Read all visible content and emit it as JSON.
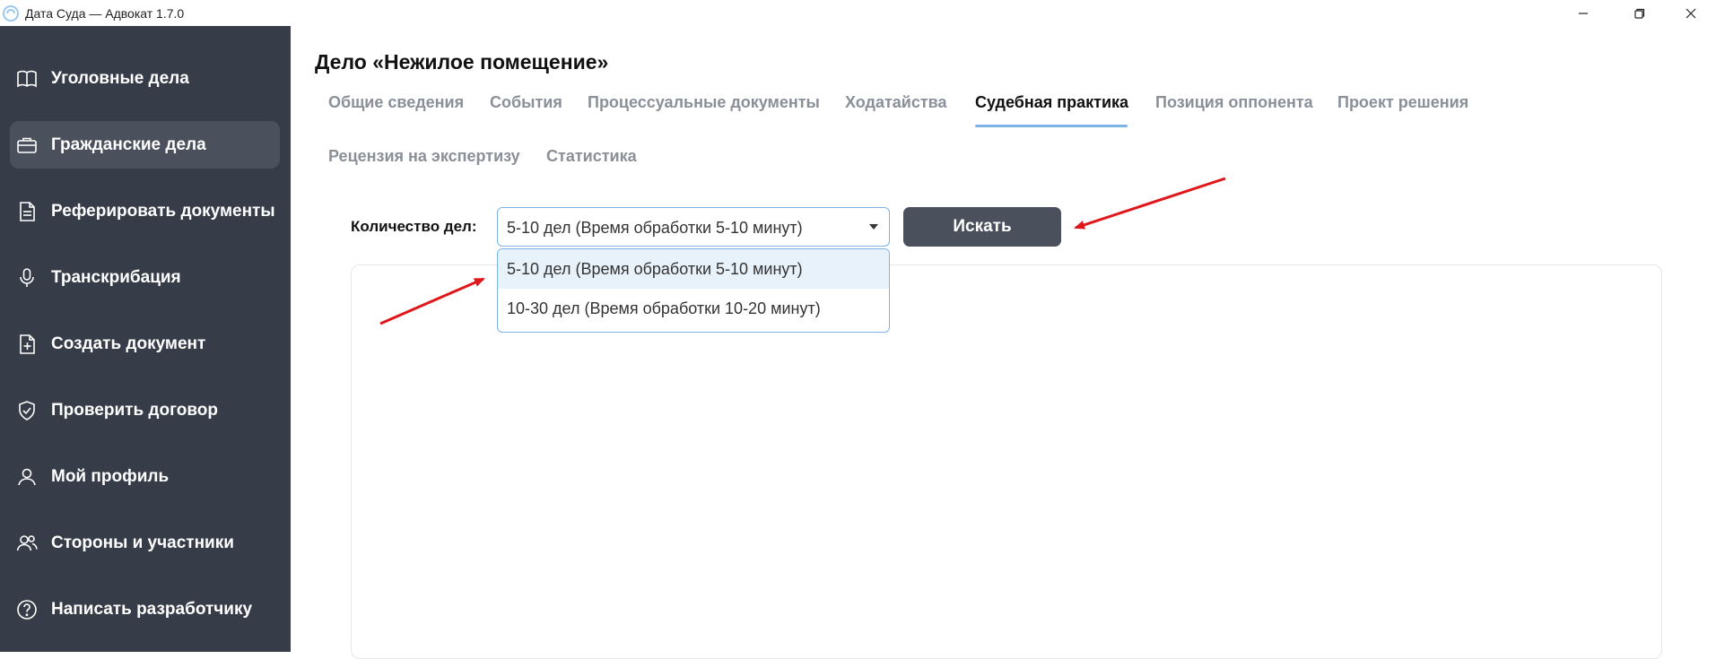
{
  "window": {
    "title": "Дата Суда — Адвокат 1.7.0",
    "controls": [
      "minimize-icon",
      "restore-icon",
      "close-icon"
    ]
  },
  "sidebar": {
    "items": [
      {
        "label": "Уголовные дела",
        "icon": "book-icon"
      },
      {
        "label": "Гражданские дела",
        "icon": "briefcase-icon",
        "active": true
      },
      {
        "label": "Реферировать документы",
        "icon": "document-icon"
      },
      {
        "label": "Транскрибация",
        "icon": "microphone-icon"
      },
      {
        "label": "Создать документ",
        "icon": "file-plus-icon"
      },
      {
        "label": "Проверить договор",
        "icon": "shield-check-icon"
      },
      {
        "label": "Мой профиль",
        "icon": "user-icon"
      },
      {
        "label": "Стороны и участники",
        "icon": "users-icon"
      },
      {
        "label": "Написать разработчику",
        "icon": "help-circle-icon"
      }
    ]
  },
  "main": {
    "case_title": "Дело «Нежилое помещение»",
    "tabs": [
      {
        "label": "Общие сведения"
      },
      {
        "label": "События"
      },
      {
        "label": "Процессуальные документы"
      },
      {
        "label": "Ходатайства"
      },
      {
        "label": "Судебная практика",
        "active": true
      },
      {
        "label": "Позиция оппонента"
      },
      {
        "label": "Проект решения"
      },
      {
        "label": "Рецензия на экспертизу"
      },
      {
        "label": "Статистика"
      }
    ],
    "count_label": "Количество дел:",
    "select": {
      "value": "5-10 дел (Время обработки 5-10 минут)",
      "options": [
        "5-10 дел (Время обработки 5-10 минут)",
        "10-30 дел (Время обработки 10-20 минут)"
      ]
    },
    "search_button": "Искать"
  },
  "colors": {
    "sidebar_bg": "#363c48",
    "sidebar_active": "#4a505c",
    "accent": "#7fb3e6",
    "button_bg": "#4a505c",
    "annotation_arrow": "#e0161b"
  }
}
